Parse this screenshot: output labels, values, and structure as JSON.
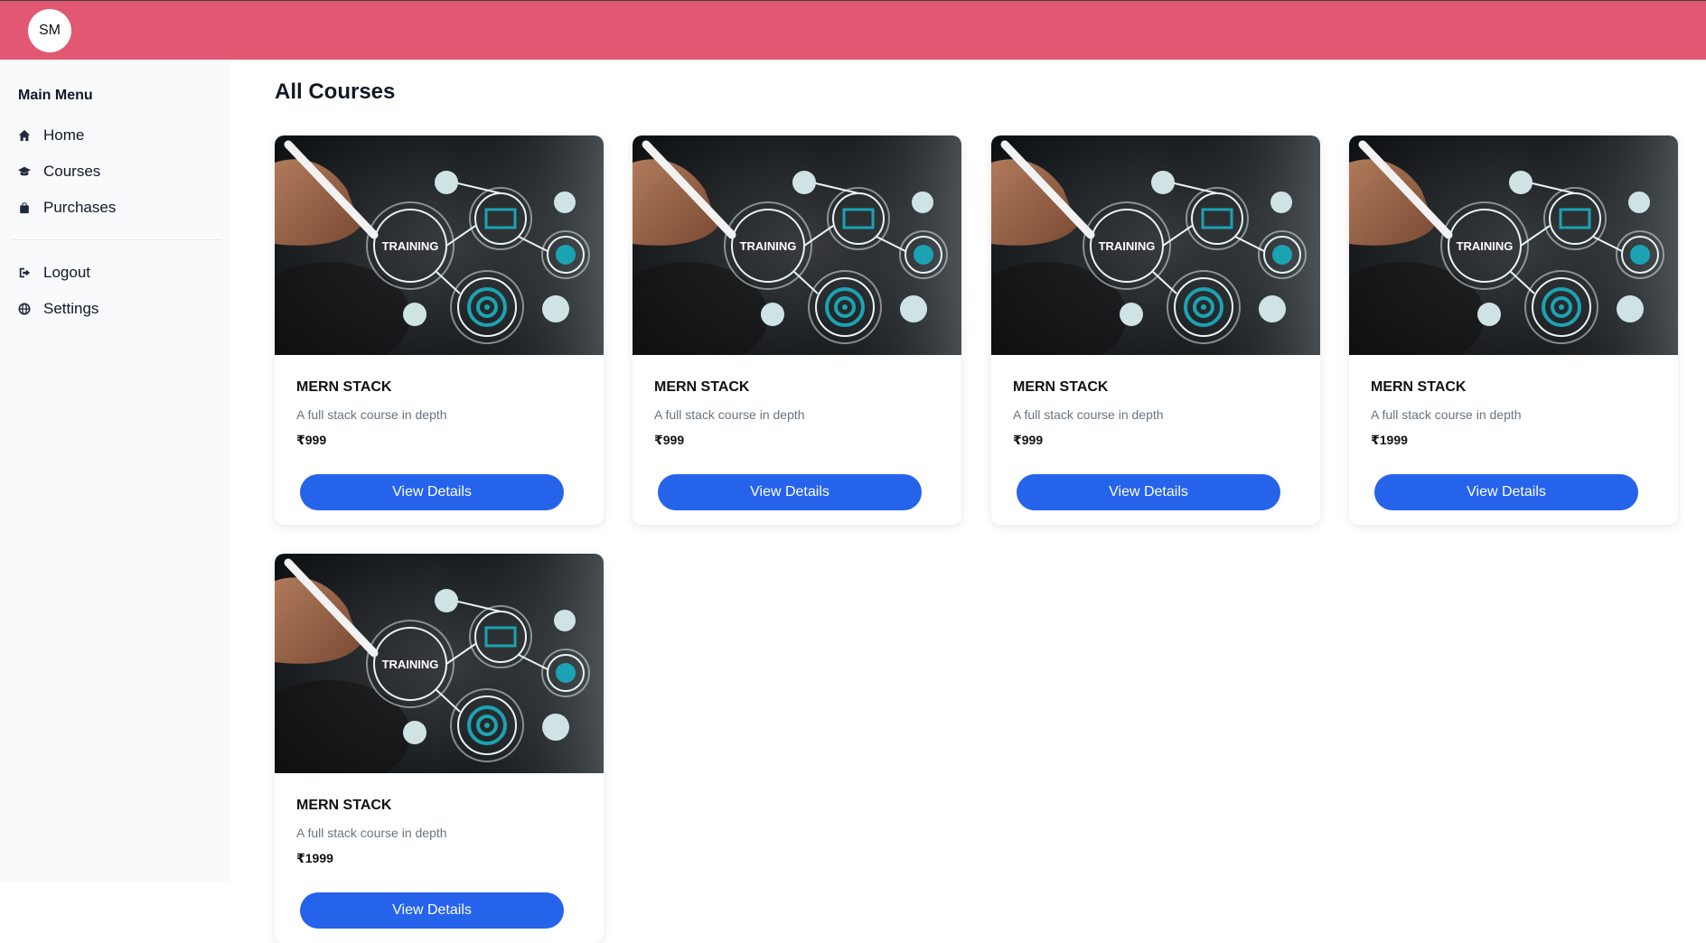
{
  "header": {
    "avatar_initials": "SM",
    "color": "#e25771"
  },
  "sidebar": {
    "title": "Main Menu",
    "items": [
      {
        "label": "Home",
        "icon": "home-icon"
      },
      {
        "label": "Courses",
        "icon": "graduation-cap-icon"
      },
      {
        "label": "Purchases",
        "icon": "shopping-bag-icon"
      },
      {
        "label": "Logout",
        "icon": "logout-icon"
      },
      {
        "label": "Settings",
        "icon": "globe-icon"
      }
    ]
  },
  "main": {
    "title": "All Courses",
    "courses": [
      {
        "title": "MERN STACK",
        "description": "A full stack course in depth",
        "price": "₹999",
        "button": "View Details",
        "image_text": "TRAINING"
      },
      {
        "title": "MERN STACK",
        "description": "A full stack course in depth",
        "price": "₹999",
        "button": "View Details",
        "image_text": "TRAINING"
      },
      {
        "title": "MERN STACK",
        "description": "A full stack course in depth",
        "price": "₹999",
        "button": "View Details",
        "image_text": "TRAINING"
      },
      {
        "title": "MERN STACK",
        "description": "A full stack course in depth",
        "price": "₹1999",
        "button": "View Details",
        "image_text": "TRAINING"
      },
      {
        "title": "MERN STACK",
        "description": "A full stack course in depth",
        "price": "₹1999",
        "button": "View Details",
        "image_text": "TRAINING"
      }
    ]
  },
  "colors": {
    "accent": "#2563eb",
    "header": "#e25771",
    "sidebar_bg": "#f8fafc"
  }
}
